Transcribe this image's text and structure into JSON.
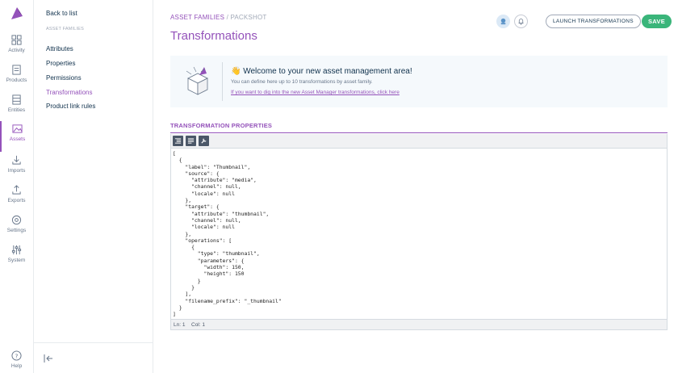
{
  "nav": {
    "items": [
      {
        "label": "Activity",
        "icon": "activity-icon"
      },
      {
        "label": "Products",
        "icon": "products-icon"
      },
      {
        "label": "Entities",
        "icon": "entities-icon"
      },
      {
        "label": "Assets",
        "icon": "assets-icon",
        "active": true
      },
      {
        "label": "Imports",
        "icon": "imports-icon"
      },
      {
        "label": "Exports",
        "icon": "exports-icon"
      },
      {
        "label": "Settings",
        "icon": "settings-icon"
      },
      {
        "label": "System",
        "icon": "system-icon"
      }
    ],
    "help_label": "Help"
  },
  "subnav": {
    "back_label": "Back to list",
    "section_label": "ASSET FAMILIES",
    "links": [
      "Attributes",
      "Properties",
      "Permissions",
      "Transformations",
      "Product link rules"
    ],
    "active_link": "Transformations"
  },
  "header": {
    "breadcrumb_parent": "ASSET FAMILIES",
    "breadcrumb_separator": "/",
    "breadcrumb_current": "PACKSHOT",
    "title": "Transformations",
    "launch_label": "LAUNCH TRANSFORMATIONS",
    "save_label": "SAVE"
  },
  "welcome": {
    "title": "👋 Welcome to your new asset management area!",
    "text": "You can define here up to 10 transformations by asset family.",
    "link": "If you want to dig into the new Asset Manager transformations, click here"
  },
  "editor": {
    "section_title": "TRANSFORMATION PROPERTIES",
    "code": "[\n  {\n    \"label\": \"Thumbnail\",\n    \"source\": {\n      \"attribute\": \"media\",\n      \"channel\": null,\n      \"locale\": null\n    },\n    \"target\": {\n      \"attribute\": \"thumbnail\",\n      \"channel\": null,\n      \"locale\": null\n    },\n    \"operations\": [\n      {\n        \"type\": \"thumbnail\",\n        \"parameters\": {\n          \"width\": 150,\n          \"height\": 150\n        }\n      }\n    ],\n    \"filename_prefix\": \"_thumbnail\"\n  }\n]",
    "status_ln": "Ln: 1",
    "status_col": "Col: 1"
  },
  "colors": {
    "accent": "#9452ba",
    "save": "#3ab57a",
    "text": "#11324d"
  }
}
